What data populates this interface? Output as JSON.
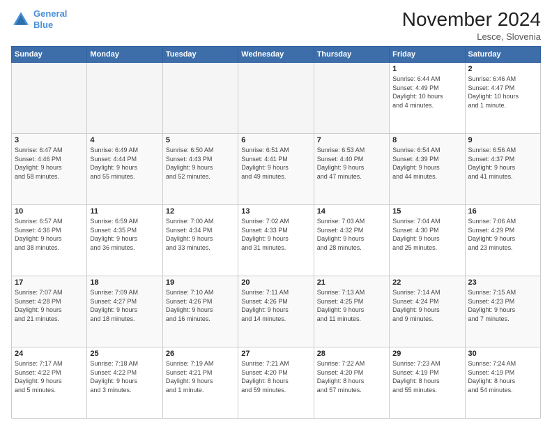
{
  "header": {
    "logo_line1": "General",
    "logo_line2": "Blue",
    "month": "November 2024",
    "location": "Lesce, Slovenia"
  },
  "weekdays": [
    "Sunday",
    "Monday",
    "Tuesday",
    "Wednesday",
    "Thursday",
    "Friday",
    "Saturday"
  ],
  "weeks": [
    [
      {
        "day": "",
        "info": ""
      },
      {
        "day": "",
        "info": ""
      },
      {
        "day": "",
        "info": ""
      },
      {
        "day": "",
        "info": ""
      },
      {
        "day": "",
        "info": ""
      },
      {
        "day": "1",
        "info": "Sunrise: 6:44 AM\nSunset: 4:49 PM\nDaylight: 10 hours\nand 4 minutes."
      },
      {
        "day": "2",
        "info": "Sunrise: 6:46 AM\nSunset: 4:47 PM\nDaylight: 10 hours\nand 1 minute."
      }
    ],
    [
      {
        "day": "3",
        "info": "Sunrise: 6:47 AM\nSunset: 4:46 PM\nDaylight: 9 hours\nand 58 minutes."
      },
      {
        "day": "4",
        "info": "Sunrise: 6:49 AM\nSunset: 4:44 PM\nDaylight: 9 hours\nand 55 minutes."
      },
      {
        "day": "5",
        "info": "Sunrise: 6:50 AM\nSunset: 4:43 PM\nDaylight: 9 hours\nand 52 minutes."
      },
      {
        "day": "6",
        "info": "Sunrise: 6:51 AM\nSunset: 4:41 PM\nDaylight: 9 hours\nand 49 minutes."
      },
      {
        "day": "7",
        "info": "Sunrise: 6:53 AM\nSunset: 4:40 PM\nDaylight: 9 hours\nand 47 minutes."
      },
      {
        "day": "8",
        "info": "Sunrise: 6:54 AM\nSunset: 4:39 PM\nDaylight: 9 hours\nand 44 minutes."
      },
      {
        "day": "9",
        "info": "Sunrise: 6:56 AM\nSunset: 4:37 PM\nDaylight: 9 hours\nand 41 minutes."
      }
    ],
    [
      {
        "day": "10",
        "info": "Sunrise: 6:57 AM\nSunset: 4:36 PM\nDaylight: 9 hours\nand 38 minutes."
      },
      {
        "day": "11",
        "info": "Sunrise: 6:59 AM\nSunset: 4:35 PM\nDaylight: 9 hours\nand 36 minutes."
      },
      {
        "day": "12",
        "info": "Sunrise: 7:00 AM\nSunset: 4:34 PM\nDaylight: 9 hours\nand 33 minutes."
      },
      {
        "day": "13",
        "info": "Sunrise: 7:02 AM\nSunset: 4:33 PM\nDaylight: 9 hours\nand 31 minutes."
      },
      {
        "day": "14",
        "info": "Sunrise: 7:03 AM\nSunset: 4:32 PM\nDaylight: 9 hours\nand 28 minutes."
      },
      {
        "day": "15",
        "info": "Sunrise: 7:04 AM\nSunset: 4:30 PM\nDaylight: 9 hours\nand 25 minutes."
      },
      {
        "day": "16",
        "info": "Sunrise: 7:06 AM\nSunset: 4:29 PM\nDaylight: 9 hours\nand 23 minutes."
      }
    ],
    [
      {
        "day": "17",
        "info": "Sunrise: 7:07 AM\nSunset: 4:28 PM\nDaylight: 9 hours\nand 21 minutes."
      },
      {
        "day": "18",
        "info": "Sunrise: 7:09 AM\nSunset: 4:27 PM\nDaylight: 9 hours\nand 18 minutes."
      },
      {
        "day": "19",
        "info": "Sunrise: 7:10 AM\nSunset: 4:26 PM\nDaylight: 9 hours\nand 16 minutes."
      },
      {
        "day": "20",
        "info": "Sunrise: 7:11 AM\nSunset: 4:26 PM\nDaylight: 9 hours\nand 14 minutes."
      },
      {
        "day": "21",
        "info": "Sunrise: 7:13 AM\nSunset: 4:25 PM\nDaylight: 9 hours\nand 11 minutes."
      },
      {
        "day": "22",
        "info": "Sunrise: 7:14 AM\nSunset: 4:24 PM\nDaylight: 9 hours\nand 9 minutes."
      },
      {
        "day": "23",
        "info": "Sunrise: 7:15 AM\nSunset: 4:23 PM\nDaylight: 9 hours\nand 7 minutes."
      }
    ],
    [
      {
        "day": "24",
        "info": "Sunrise: 7:17 AM\nSunset: 4:22 PM\nDaylight: 9 hours\nand 5 minutes."
      },
      {
        "day": "25",
        "info": "Sunrise: 7:18 AM\nSunset: 4:22 PM\nDaylight: 9 hours\nand 3 minutes."
      },
      {
        "day": "26",
        "info": "Sunrise: 7:19 AM\nSunset: 4:21 PM\nDaylight: 9 hours\nand 1 minute."
      },
      {
        "day": "27",
        "info": "Sunrise: 7:21 AM\nSunset: 4:20 PM\nDaylight: 8 hours\nand 59 minutes."
      },
      {
        "day": "28",
        "info": "Sunrise: 7:22 AM\nSunset: 4:20 PM\nDaylight: 8 hours\nand 57 minutes."
      },
      {
        "day": "29",
        "info": "Sunrise: 7:23 AM\nSunset: 4:19 PM\nDaylight: 8 hours\nand 55 minutes."
      },
      {
        "day": "30",
        "info": "Sunrise: 7:24 AM\nSunset: 4:19 PM\nDaylight: 8 hours\nand 54 minutes."
      }
    ]
  ]
}
